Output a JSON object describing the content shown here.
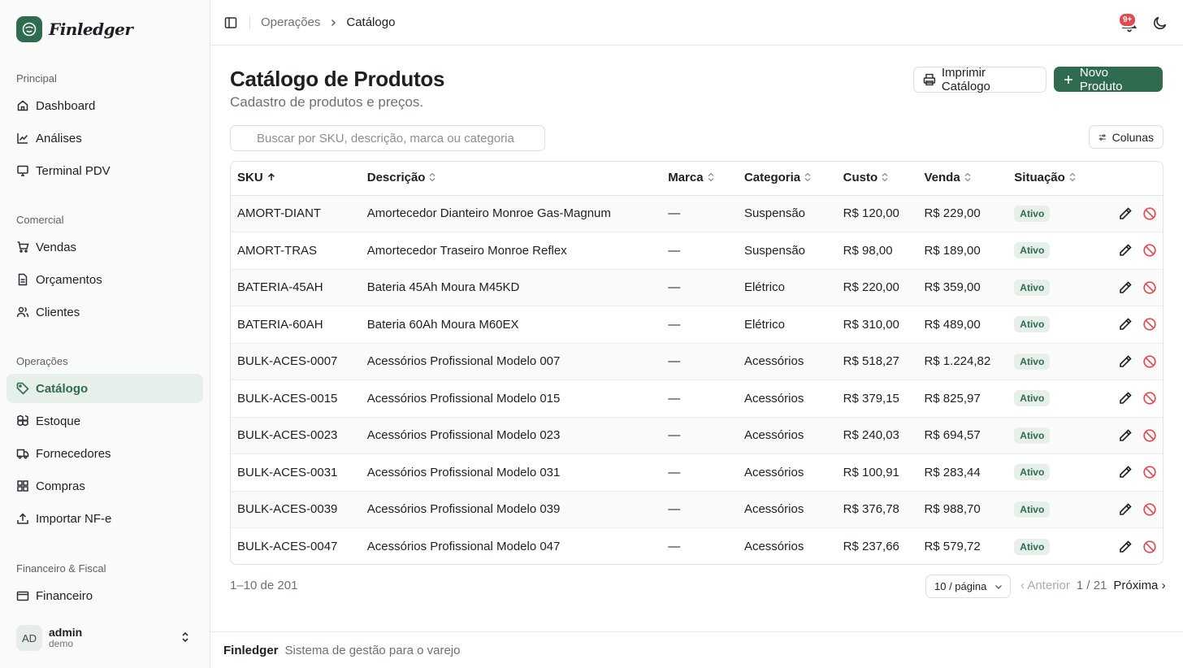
{
  "brand": {
    "name": "Finledger"
  },
  "sidebar": {
    "groups": [
      {
        "label": "Principal",
        "items": [
          {
            "label": "Dashboard",
            "icon": "home-icon"
          },
          {
            "label": "Análises",
            "icon": "chart-line-icon"
          },
          {
            "label": "Terminal PDV",
            "icon": "monitor-icon"
          }
        ]
      },
      {
        "label": "Comercial",
        "items": [
          {
            "label": "Vendas",
            "icon": "cart-icon"
          },
          {
            "label": "Orçamentos",
            "icon": "file-text-icon"
          },
          {
            "label": "Clientes",
            "icon": "users-icon"
          }
        ]
      },
      {
        "label": "Operações",
        "items": [
          {
            "label": "Catálogo",
            "icon": "tag-icon",
            "active": true
          },
          {
            "label": "Estoque",
            "icon": "boxes-icon"
          },
          {
            "label": "Fornecedores",
            "icon": "truck-icon"
          },
          {
            "label": "Compras",
            "icon": "grid-icon"
          },
          {
            "label": "Importar NF-e",
            "icon": "upload-icon"
          }
        ]
      },
      {
        "label": "Financeiro & Fiscal",
        "items": [
          {
            "label": "Financeiro",
            "icon": "wallet-icon"
          }
        ]
      }
    ],
    "user": {
      "initials": "AD",
      "name": "admin",
      "role": "demo"
    }
  },
  "header": {
    "breadcrumb": [
      "Operações",
      "Catálogo"
    ],
    "notifications_badge": "9+"
  },
  "page": {
    "title": "Catálogo de Produtos",
    "subtitle": "Cadastro de produtos e preços.",
    "print_label": "Imprimir Catálogo",
    "new_label": "Novo Produto",
    "search_placeholder": "Buscar por SKU, descrição, marca ou categoria",
    "columns_label": "Colunas"
  },
  "table": {
    "columns": [
      "SKU",
      "Descrição",
      "Marca",
      "Categoria",
      "Custo",
      "Venda",
      "Situação"
    ],
    "sorted_column": "SKU",
    "rows": [
      {
        "sku": "AMORT-DIANT",
        "desc": "Amortecedor Dianteiro Monroe Gas-Magnum",
        "brand": "—",
        "category": "Suspensão",
        "cost": "R$ 120,00",
        "price": "R$ 229,00",
        "status": "Ativo"
      },
      {
        "sku": "AMORT-TRAS",
        "desc": "Amortecedor Traseiro Monroe Reflex",
        "brand": "—",
        "category": "Suspensão",
        "cost": "R$ 98,00",
        "price": "R$ 189,00",
        "status": "Ativo"
      },
      {
        "sku": "BATERIA-45AH",
        "desc": "Bateria 45Ah Moura M45KD",
        "brand": "—",
        "category": "Elétrico",
        "cost": "R$ 220,00",
        "price": "R$ 359,00",
        "status": "Ativo"
      },
      {
        "sku": "BATERIA-60AH",
        "desc": "Bateria 60Ah Moura M60EX",
        "brand": "—",
        "category": "Elétrico",
        "cost": "R$ 310,00",
        "price": "R$ 489,00",
        "status": "Ativo"
      },
      {
        "sku": "BULK-ACES-0007",
        "desc": "Acessórios Profissional Modelo 007",
        "brand": "—",
        "category": "Acessórios",
        "cost": "R$ 518,27",
        "price": "R$ 1.224,82",
        "status": "Ativo"
      },
      {
        "sku": "BULK-ACES-0015",
        "desc": "Acessórios Profissional Modelo 015",
        "brand": "—",
        "category": "Acessórios",
        "cost": "R$ 379,15",
        "price": "R$ 825,97",
        "status": "Ativo"
      },
      {
        "sku": "BULK-ACES-0023",
        "desc": "Acessórios Profissional Modelo 023",
        "brand": "—",
        "category": "Acessórios",
        "cost": "R$ 240,03",
        "price": "R$ 694,57",
        "status": "Ativo"
      },
      {
        "sku": "BULK-ACES-0031",
        "desc": "Acessórios Profissional Modelo 031",
        "brand": "—",
        "category": "Acessórios",
        "cost": "R$ 100,91",
        "price": "R$ 283,44",
        "status": "Ativo"
      },
      {
        "sku": "BULK-ACES-0039",
        "desc": "Acessórios Profissional Modelo 039",
        "brand": "—",
        "category": "Acessórios",
        "cost": "R$ 376,78",
        "price": "R$ 988,70",
        "status": "Ativo"
      },
      {
        "sku": "BULK-ACES-0047",
        "desc": "Acessórios Profissional Modelo 047",
        "brand": "—",
        "category": "Acessórios",
        "cost": "R$ 237,66",
        "price": "R$ 579,72",
        "status": "Ativo"
      }
    ]
  },
  "pagination": {
    "range": "1–10 de 201",
    "per_page": "10 / página",
    "prev": "‹ Anterior",
    "info": "1 / 21",
    "next": "Próxima ›"
  },
  "footer": {
    "brand": "Finledger",
    "tagline": "Sistema de gestão para o varejo"
  },
  "colors": {
    "accent": "#2f6b4f",
    "accent_soft": "#e6efe9",
    "danger": "#e5484d"
  }
}
